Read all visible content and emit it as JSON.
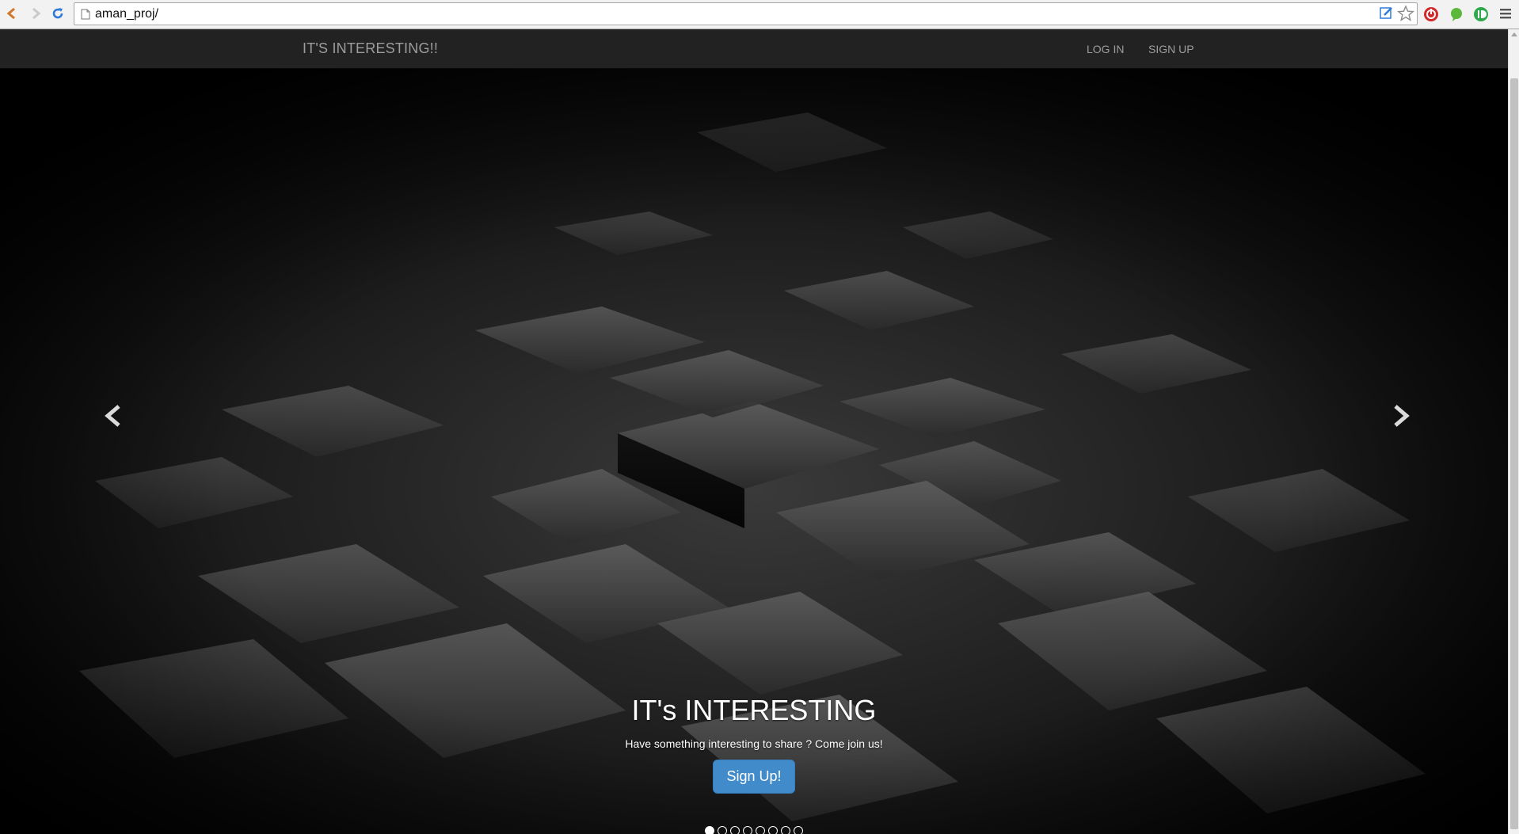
{
  "browser": {
    "url": "aman_proj/"
  },
  "navbar": {
    "brand": "IT'S INTERESTING!!",
    "links": [
      {
        "label": "LOG IN"
      },
      {
        "label": "SIGN UP"
      }
    ]
  },
  "carousel": {
    "heading": "IT's INTERESTING",
    "subtext": "Have something interesting to share ? Come join us!",
    "cta_label": "Sign Up!",
    "active_slide": 1,
    "total_slides": 8
  },
  "colors": {
    "navbar_bg": "#222222",
    "nav_text": "#9d9d9d",
    "cta": "#428bca"
  }
}
